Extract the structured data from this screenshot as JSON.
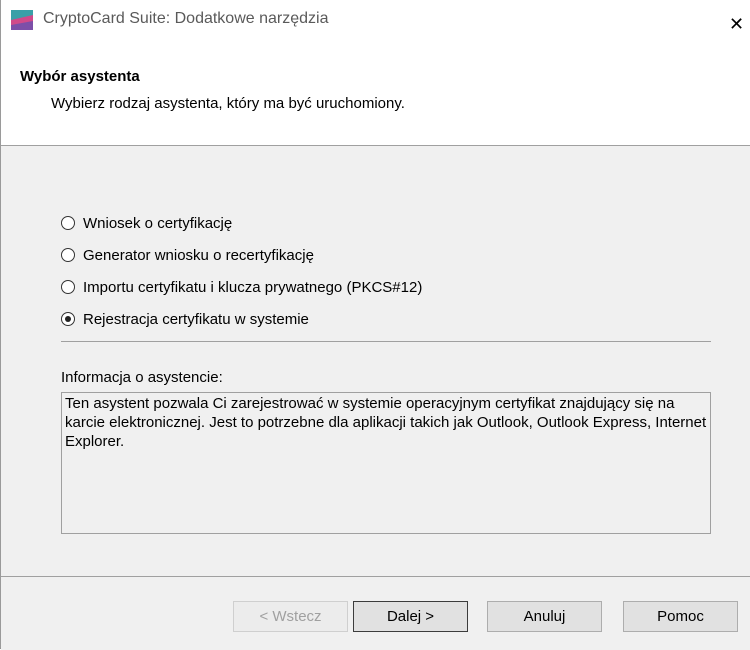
{
  "window": {
    "title": "CryptoCard Suite: Dodatkowe narzędzia",
    "close_glyph": "✕"
  },
  "header": {
    "title": "Wybór asystenta",
    "subtitle": "Wybierz rodzaj asystenta, który ma być uruchomiony."
  },
  "options": [
    {
      "label": "Wniosek o certyfikację",
      "selected": false
    },
    {
      "label": "Generator wniosku o recertyfikację",
      "selected": false
    },
    {
      "label": "Importu certyfikatu i klucza prywatnego (PKCS#12)",
      "selected": false
    },
    {
      "label": "Rejestracja certyfikatu w systemie",
      "selected": true
    }
  ],
  "info": {
    "label": "Informacja o asystencie:",
    "text": "Ten asystent pozwala Ci zarejestrować w systemie operacyjnym certyfikat znajdujący się na karcie elektronicznej. Jest to potrzebne dla aplikacji takich jak Outlook, Outlook Express, Internet Explorer."
  },
  "buttons": {
    "back": "< Wstecz",
    "next": "Dalej >",
    "cancel": "Anuluj",
    "help": "Pomoc"
  },
  "colors": {
    "body_bg": "#f0f0f0",
    "header_bg": "#ffffff",
    "disabled_text": "#a0a0a0"
  }
}
